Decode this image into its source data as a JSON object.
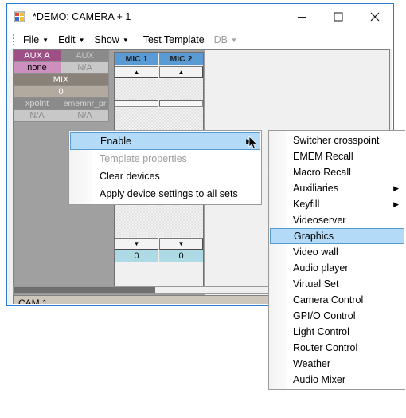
{
  "window": {
    "title": "*DEMO: CAMERA + 1",
    "icon": "form-icon",
    "caption_buttons": [
      {
        "name": "minimize",
        "glyph": "minimize-icon"
      },
      {
        "name": "maximize",
        "glyph": "maximize-icon"
      },
      {
        "name": "close",
        "glyph": "close-icon"
      }
    ],
    "border_color": "#2b7cd3"
  },
  "menubar": {
    "items": [
      {
        "label": "File",
        "has_caret": true,
        "disabled": false
      },
      {
        "label": "Edit",
        "has_caret": true,
        "disabled": false
      },
      {
        "label": "Show",
        "has_caret": true,
        "disabled": false
      },
      {
        "label": "Test Template",
        "has_caret": false,
        "disabled": false
      },
      {
        "label": "DB",
        "has_caret": true,
        "disabled": true
      }
    ],
    "caret_glyph": "▼"
  },
  "aux_grid": {
    "rows": [
      {
        "left": "AUX A",
        "right": "AUX"
      },
      {
        "left": "none",
        "right": "N/A"
      },
      {
        "full": "MIX"
      },
      {
        "full": "0"
      },
      {
        "left": "xpoint",
        "right": "ememnr_pr"
      },
      {
        "left": "N/A",
        "right": "N/A"
      }
    ],
    "colors": {
      "aux_a_header": "#9e4f85",
      "aux_a_value": "#cc8fbe",
      "aux_header": "#8a8a8a",
      "mix_header": "#8a8279",
      "mix_value": "#b3aa9f"
    }
  },
  "mic_panel": {
    "channels": [
      {
        "title": "MIC 1",
        "up": "▲",
        "down": "▼",
        "value": "0"
      },
      {
        "title": "MIC 2",
        "up": "▲",
        "down": "▼",
        "value": "0"
      }
    ],
    "header_color": "#5b9bd5",
    "value_color": "#aedae5"
  },
  "status": {
    "cam_label": "CAM 1"
  },
  "context_menu": {
    "items": [
      {
        "label": "Enable",
        "selected": true,
        "disabled": false,
        "submenu": true,
        "arrow": "▶"
      },
      {
        "label": "Template properties",
        "selected": false,
        "disabled": true,
        "submenu": false,
        "arrow": ""
      },
      {
        "label": "Clear devices",
        "selected": false,
        "disabled": false,
        "submenu": false,
        "arrow": ""
      },
      {
        "label": "Apply device settings to all sets",
        "selected": false,
        "disabled": false,
        "submenu": false,
        "arrow": ""
      }
    ]
  },
  "submenu": {
    "items": [
      {
        "label": "Switcher crosspoint",
        "selected": false,
        "submenu": false,
        "arrow": ""
      },
      {
        "label": "EMEM Recall",
        "selected": false,
        "submenu": false,
        "arrow": ""
      },
      {
        "label": "Macro Recall",
        "selected": false,
        "submenu": false,
        "arrow": ""
      },
      {
        "label": "Auxiliaries",
        "selected": false,
        "submenu": true,
        "arrow": "▶"
      },
      {
        "label": "Keyfill",
        "selected": false,
        "submenu": true,
        "arrow": "▶"
      },
      {
        "label": "Videoserver",
        "selected": false,
        "submenu": false,
        "arrow": ""
      },
      {
        "label": "Graphics",
        "selected": true,
        "submenu": false,
        "arrow": ""
      },
      {
        "label": "Video wall",
        "selected": false,
        "submenu": false,
        "arrow": ""
      },
      {
        "label": "Audio player",
        "selected": false,
        "submenu": false,
        "arrow": ""
      },
      {
        "label": "Virtual Set",
        "selected": false,
        "submenu": false,
        "arrow": ""
      },
      {
        "label": "Camera Control",
        "selected": false,
        "submenu": false,
        "arrow": ""
      },
      {
        "label": "GPI/O Control",
        "selected": false,
        "submenu": false,
        "arrow": ""
      },
      {
        "label": "Light Control",
        "selected": false,
        "submenu": false,
        "arrow": ""
      },
      {
        "label": "Router Control",
        "selected": false,
        "submenu": false,
        "arrow": ""
      },
      {
        "label": "Weather",
        "selected": false,
        "submenu": false,
        "arrow": ""
      },
      {
        "label": "Audio Mixer",
        "selected": false,
        "submenu": false,
        "arrow": ""
      }
    ],
    "highlight_color": "#b3daf7"
  }
}
